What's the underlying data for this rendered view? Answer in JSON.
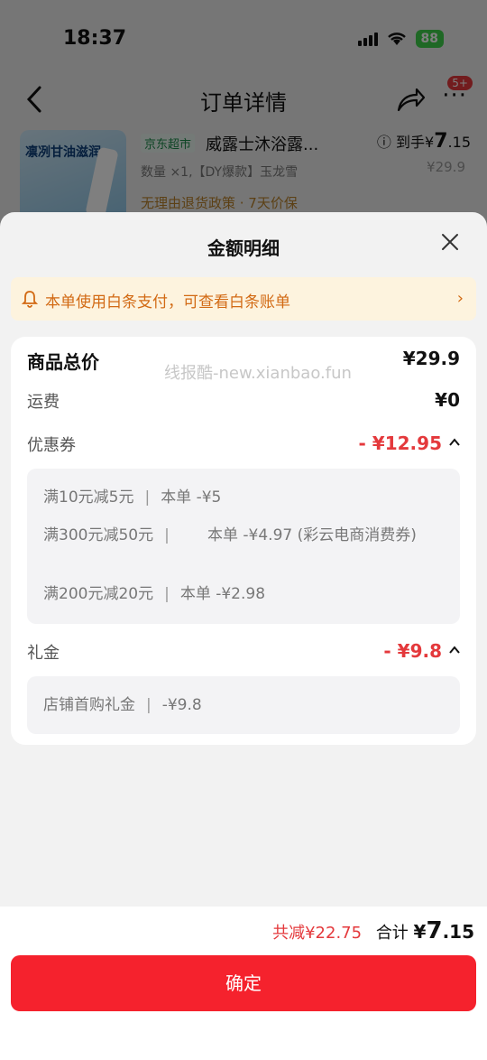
{
  "status_bar": {
    "time": "18:37",
    "battery": "88"
  },
  "nav": {
    "title": "订单详情",
    "badge": "5+"
  },
  "product": {
    "thumb_text": "凛冽甘油滋润",
    "tag": "京东超市",
    "name": "威露士沐浴露...",
    "price_label": "到手",
    "price_currency": "¥",
    "price_int": "7",
    "price_dec": ".15",
    "spec": "数量 ×1,【DY爆款】玉龙雪",
    "old_price": "¥29.9",
    "policy": "无理由退货政策 · 7天价保"
  },
  "sheet": {
    "title": "金额明细",
    "notice": "本单使用白条支付，可查看白条账单",
    "watermark": "线报酷-new.xianbao.fun",
    "rows": {
      "goods_total": {
        "label": "商品总价",
        "value": "¥29.9"
      },
      "shipping": {
        "label": "运费",
        "value": "¥0"
      },
      "coupon": {
        "label": "优惠券",
        "value": "- ¥12.95"
      },
      "gift": {
        "label": "礼金",
        "value": "- ¥9.8"
      }
    },
    "coupons": [
      {
        "rule": "满10元减5元",
        "detail": "本单 -¥5"
      },
      {
        "rule": "满300元减50元",
        "detail": "本单 -¥4.97 (彩云电商消费券)"
      },
      {
        "rule": "满200元减20元",
        "detail": "本单 -¥2.98"
      }
    ],
    "gifts": [
      {
        "rule": "店铺首购礼金",
        "detail": "-¥9.8"
      }
    ]
  },
  "footer": {
    "reduced": "共减¥22.75",
    "total_label": "合计",
    "total_currency": "¥",
    "total_int": "7",
    "total_dec": ".15",
    "confirm": "确定"
  },
  "colors": {
    "accent_red": "#e4393c",
    "button_red": "#f5222d",
    "notice_bg": "#fdf3de",
    "notice_text": "#d26a14"
  }
}
